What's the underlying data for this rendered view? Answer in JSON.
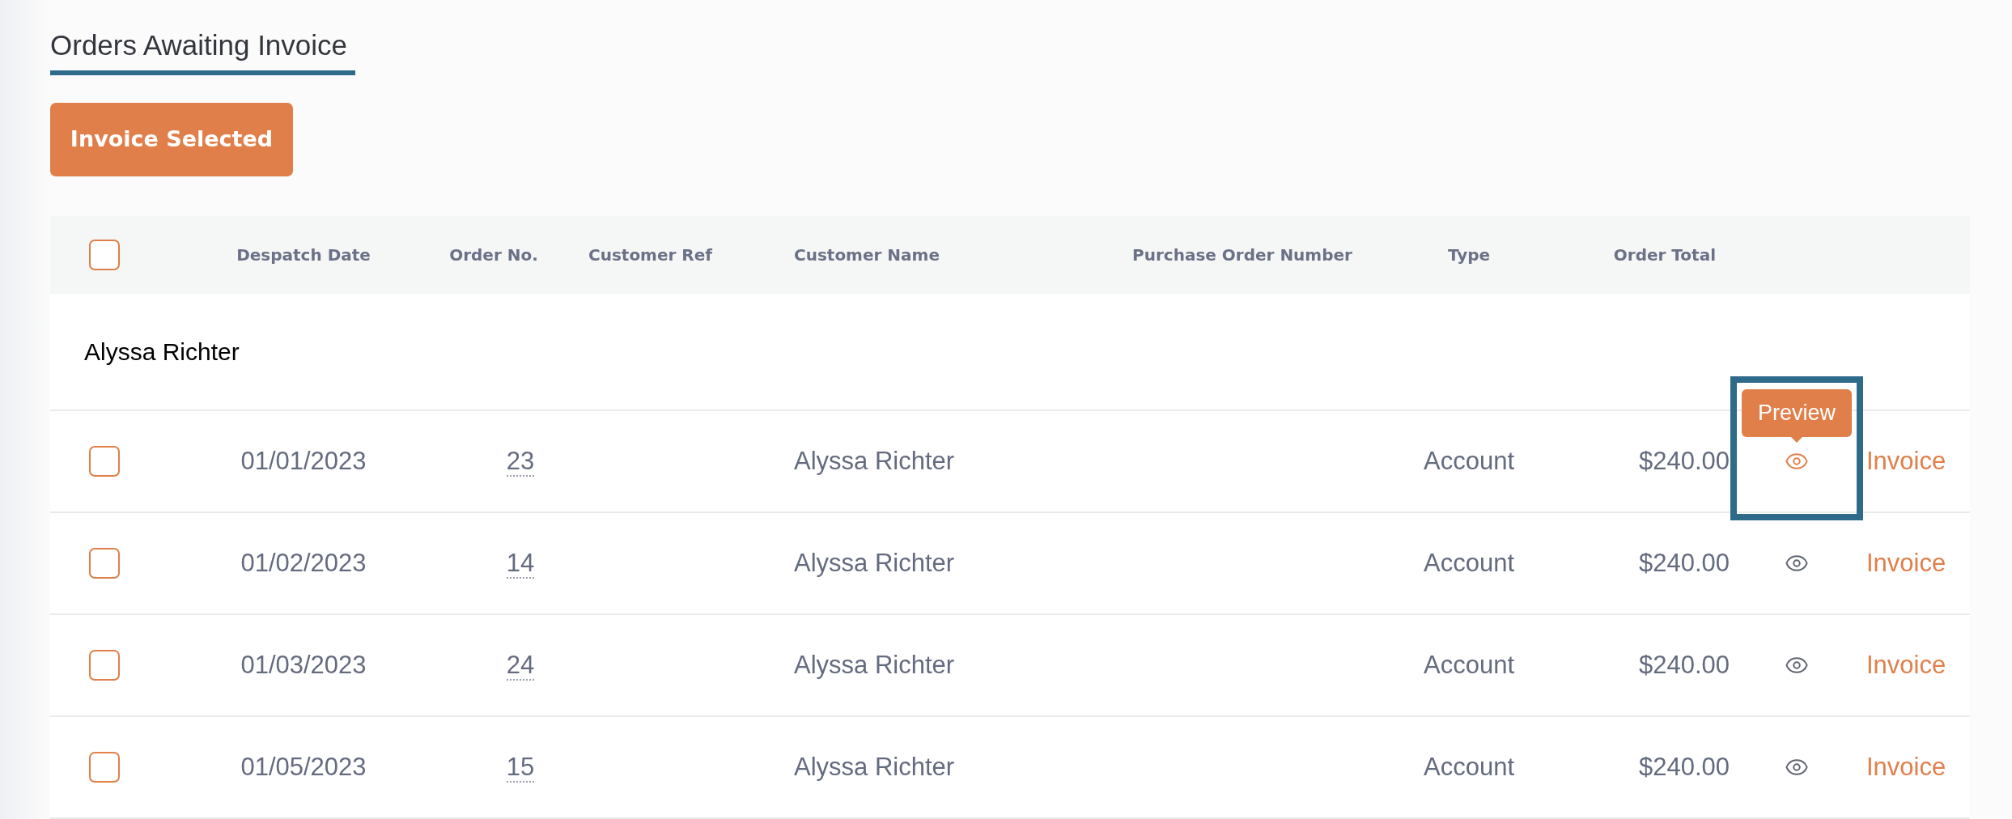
{
  "title": "Orders Awaiting Invoice",
  "invoice_selected_button": "Invoice Selected",
  "table": {
    "select_all": {
      "checked": false
    },
    "columns": [
      "Despatch Date",
      "Order No.",
      "Customer Ref",
      "Customer Name",
      "Purchase Order Number",
      "Type",
      "Order Total"
    ],
    "groups": [
      {
        "name": "Alyssa Richter",
        "rows": [
          {
            "checked": false,
            "despatch_date": "01/01/2023",
            "order_no": "23",
            "customer_name": "Alyssa Richter",
            "type": "Account",
            "order_total": "$240.00",
            "action": "Invoice",
            "preview_highlighted": true,
            "tooltip": "Preview"
          },
          {
            "checked": false,
            "despatch_date": "01/02/2023",
            "order_no": "14",
            "customer_name": "Alyssa Richter",
            "type": "Account",
            "order_total": "$240.00",
            "action": "Invoice",
            "preview_highlighted": false
          },
          {
            "checked": false,
            "despatch_date": "01/03/2023",
            "order_no": "24",
            "customer_name": "Alyssa Richter",
            "type": "Account",
            "order_total": "$240.00",
            "action": "Invoice",
            "preview_highlighted": false
          },
          {
            "checked": false,
            "despatch_date": "01/05/2023",
            "order_no": "15",
            "customer_name": "Alyssa Richter",
            "type": "Account",
            "order_total": "$240.00",
            "action": "Invoice",
            "preview_highlighted": false
          }
        ]
      }
    ]
  }
}
